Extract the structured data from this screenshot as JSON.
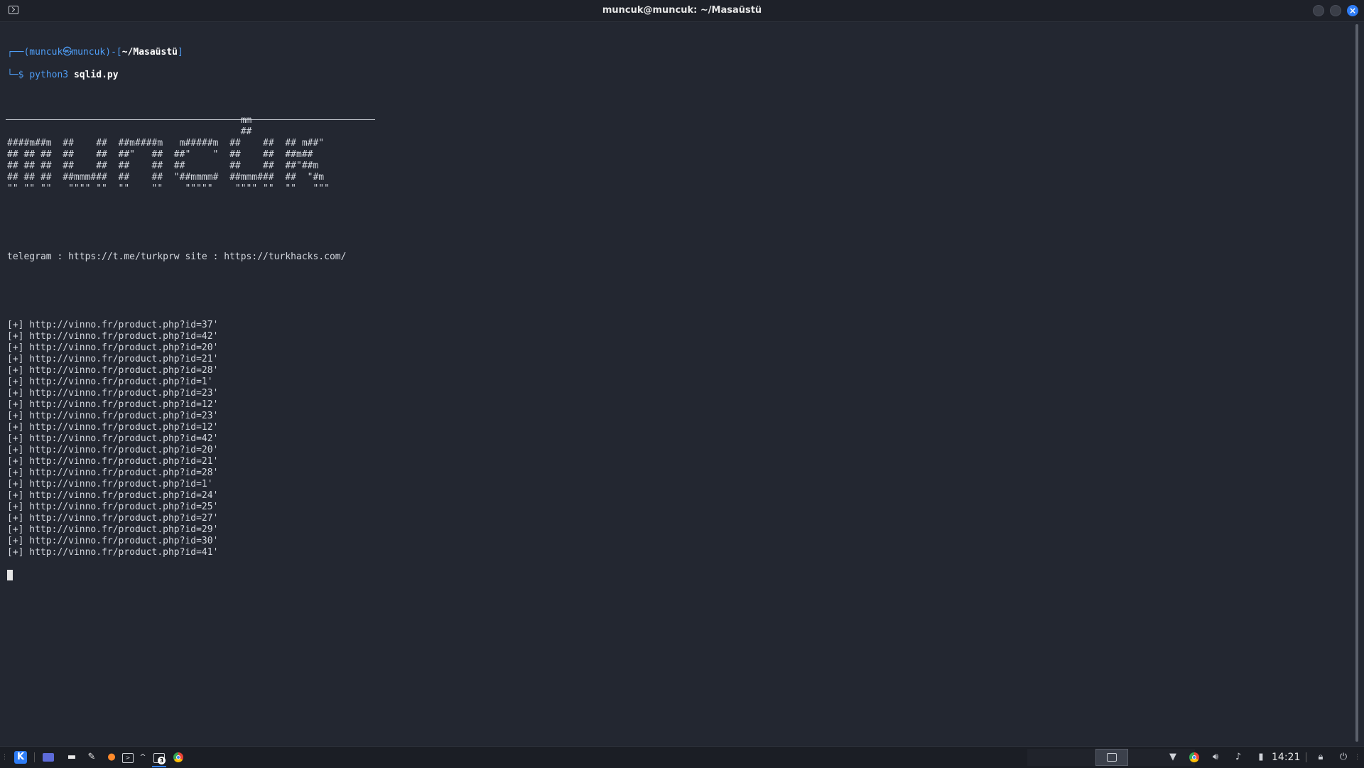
{
  "window": {
    "title": "muncuk@muncuk: ~/Masaüstü"
  },
  "terminal": {
    "prompt": {
      "corner_top": "┌──",
      "user": "(muncuk㉿muncuk)",
      "dash": "-",
      "path_open": "[",
      "path": "~/Masaüstü",
      "path_close": "]",
      "corner_bottom": "└─",
      "dollar": "$",
      "command": "python3",
      "argument": "sqlid.py"
    },
    "ascii_art": [
      "                                          mm",
      "                                          ##",
      "####m##m  ##    ##  ##m####m   m#####m  ##    ##  ## m##\"",
      "## ## ##  ##    ##  ##\"   ##  ##\"    \"  ##    ##  ##m##",
      "## ## ##  ##    ##  ##    ##  ##        ##    ##  ##\"##m",
      "## ## ##  ##mmm###  ##    ##  \"##mmmm#  ##mmm###  ##  \"#m",
      "\"\" \"\" \"\"   \"\"\"\" \"\"  \"\"    \"\"    \"\"\"\"\"    \"\"\"\" \"\"  \"\"   \"\"\""
    ],
    "info_line": "telegram : https://t.me/turkprw site : https://turkhacks.com/",
    "results": [
      "[+] http://vinno.fr/product.php?id=37'",
      "[+] http://vinno.fr/product.php?id=42'",
      "[+] http://vinno.fr/product.php?id=20'",
      "[+] http://vinno.fr/product.php?id=21'",
      "[+] http://vinno.fr/product.php?id=28'",
      "[+] http://vinno.fr/product.php?id=1'",
      "[+] http://vinno.fr/product.php?id=23'",
      "[+] http://vinno.fr/product.php?id=12'",
      "[+] http://vinno.fr/product.php?id=23'",
      "[+] http://vinno.fr/product.php?id=12'",
      "[+] http://vinno.fr/product.php?id=42'",
      "[+] http://vinno.fr/product.php?id=20'",
      "[+] http://vinno.fr/product.php?id=21'",
      "[+] http://vinno.fr/product.php?id=28'",
      "[+] http://vinno.fr/product.php?id=1'",
      "[+] http://vinno.fr/product.php?id=24'",
      "[+] http://vinno.fr/product.php?id=25'",
      "[+] http://vinno.fr/product.php?id=27'",
      "[+] http://vinno.fr/product.php?id=29'",
      "[+] http://vinno.fr/product.php?id=30'",
      "[+] http://vinno.fr/product.php?id=41'"
    ]
  },
  "taskbar": {
    "terminal_badge": "3",
    "clock": "14:21"
  },
  "icons": {
    "terminal": "terminal-icon",
    "app_menu": "app-menu-icon",
    "files": "folder-icon",
    "editor": "text-editor-icon",
    "firefox": "firefox-icon",
    "chrome": "chrome-icon",
    "wifi": "wifi-icon",
    "volume": "volume-icon",
    "bell": "notification-bell-icon",
    "battery": "battery-icon",
    "lock": "lock-icon",
    "power": "power-icon"
  },
  "colors": {
    "background": "#232731",
    "prompt_blue": "#4e9df5",
    "accent": "#2f7df6",
    "text": "#d3d7de"
  }
}
